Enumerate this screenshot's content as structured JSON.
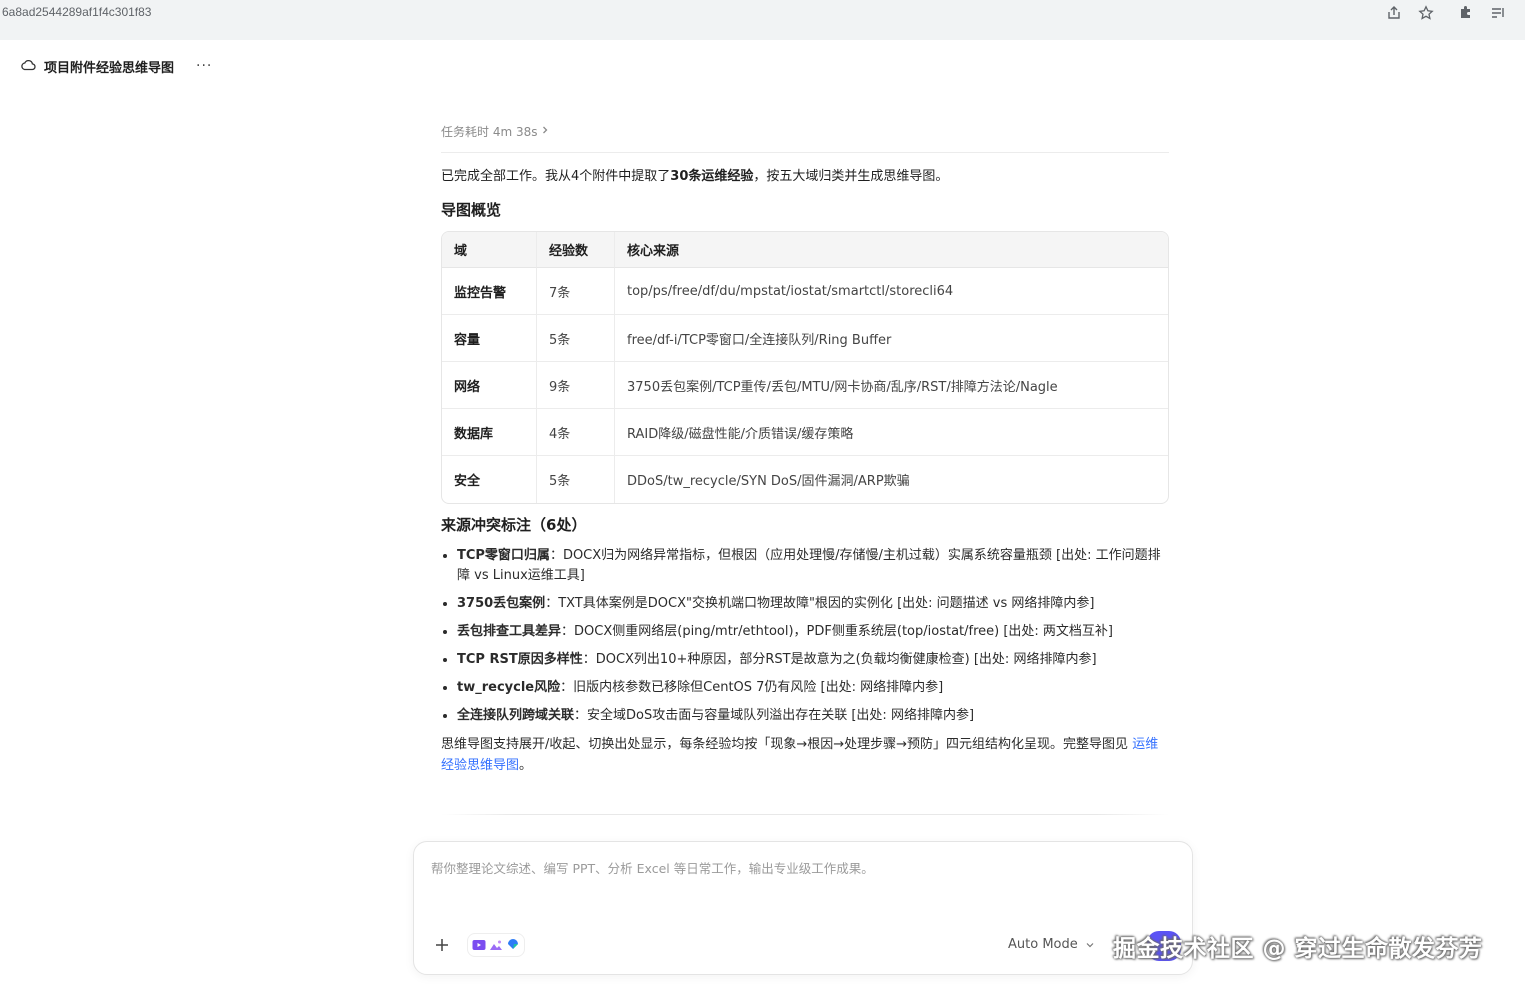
{
  "browser": {
    "url_fragment": "6a8ad2544289af1f4c301f83"
  },
  "header": {
    "title": "项目附件经验思维导图",
    "more": "···"
  },
  "task": {
    "duration": "任务耗时 4m 38s",
    "summary_prefix": "已完成全部工作。我从4个附件中提取了",
    "summary_bold": "30条运维经验",
    "summary_suffix": "，按五大域归类并生成思维导图。"
  },
  "overview": {
    "heading": "导图概览",
    "columns": [
      "域",
      "经验数",
      "核心来源"
    ],
    "rows": [
      {
        "domain": "监控告警",
        "count": "7条",
        "source": "top/ps/free/df/du/mpstat/iostat/smartctl/storecli64"
      },
      {
        "domain": "容量",
        "count": "5条",
        "source": "free/df-i/TCP零窗口/全连接队列/Ring Buffer"
      },
      {
        "domain": "网络",
        "count": "9条",
        "source": "3750丢包案例/TCP重传/丢包/MTU/网卡协商/乱序/RST/排障方法论/Nagle"
      },
      {
        "domain": "数据库",
        "count": "4条",
        "source": "RAID降级/磁盘性能/介质错误/缓存策略"
      },
      {
        "domain": "安全",
        "count": "5条",
        "source": "DDoS/tw_recycle/SYN DoS/固件漏洞/ARP欺骗"
      }
    ]
  },
  "conflicts": {
    "heading": "来源冲突标注（6处）",
    "items": [
      {
        "label": "TCP零窗口归属",
        "text": "：DOCX归为网络异常指标，但根因（应用处理慢/存储慢/主机过载）实属系统容量瓶颈 [出处: 工作问题排障 vs Linux运维工具]"
      },
      {
        "label": "3750丢包案例",
        "text": "：TXT具体案例是DOCX\"交换机端口物理故障\"根因的实例化 [出处: 问题描述 vs 网络排障内参]"
      },
      {
        "label": "丢包排查工具差异",
        "text": "：DOCX侧重网络层(ping/mtr/ethtool)，PDF侧重系统层(top/iostat/free) [出处: 两文档互补]"
      },
      {
        "label": "TCP RST原因多样性",
        "text": "：DOCX列出10+种原因，部分RST是故意为之(负载均衡健康检查) [出处: 网络排障内参]"
      },
      {
        "label": "tw_recycle风险",
        "text": "：旧版内核参数已移除但CentOS 7仍有风险 [出处: 网络排障内参]"
      },
      {
        "label": "全连接队列跨域关联",
        "text": "：安全域DoS攻击面与容量域队列溢出存在关联 [出处: 网络排障内参]"
      }
    ]
  },
  "footer": {
    "text": "思维导图支持展开/收起、切换出处显示，每条经验均按「现象→根因→处理步骤→预防」四元组结构化呈现。完整导图见 ",
    "link": "运维经验思维导图",
    "end": "。"
  },
  "composer": {
    "placeholder": "帮你整理论文综述、编写 PPT、分析 Excel 等日常工作，输出专业级工作成果。",
    "mode": "Auto Mode"
  },
  "watermark": "掘金技术社区 @ 穿过生命散发芬芳",
  "colors": {
    "accent": "#5b53f5",
    "link": "#3370ff"
  }
}
